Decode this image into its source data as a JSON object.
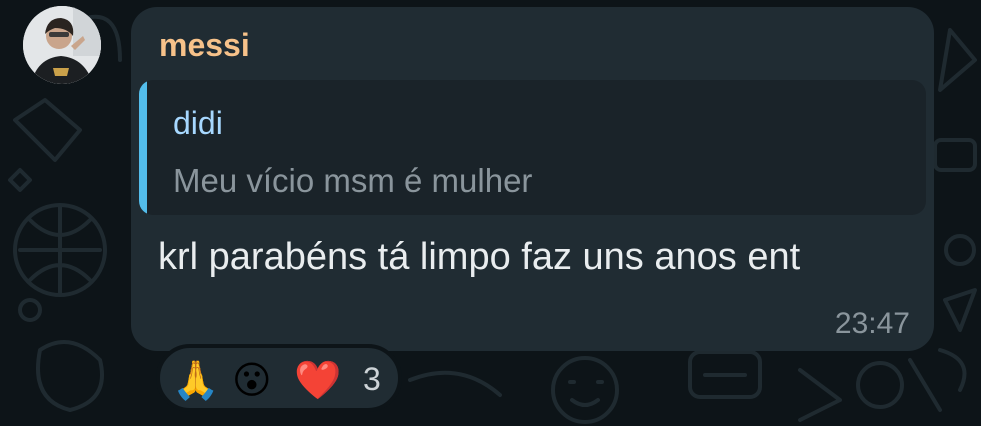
{
  "message": {
    "sender": "messi",
    "reply": {
      "author": "didi",
      "text": "Meu vício msm é mulher"
    },
    "text": "krl parabéns tá limpo faz uns anos ent",
    "time": "23:47"
  },
  "reactions": {
    "emojis": [
      "🙏",
      "😮",
      "❤️"
    ],
    "count": "3"
  },
  "colors": {
    "background": "#0d1418",
    "bubble": "#202c33",
    "quote_bg": "#1a2329",
    "quote_bar": "#53bdeb",
    "sender_name": "#f7c28a",
    "quote_author": "#a7d8ff",
    "meta_text": "#8a959c",
    "body_text": "#e9edef"
  }
}
